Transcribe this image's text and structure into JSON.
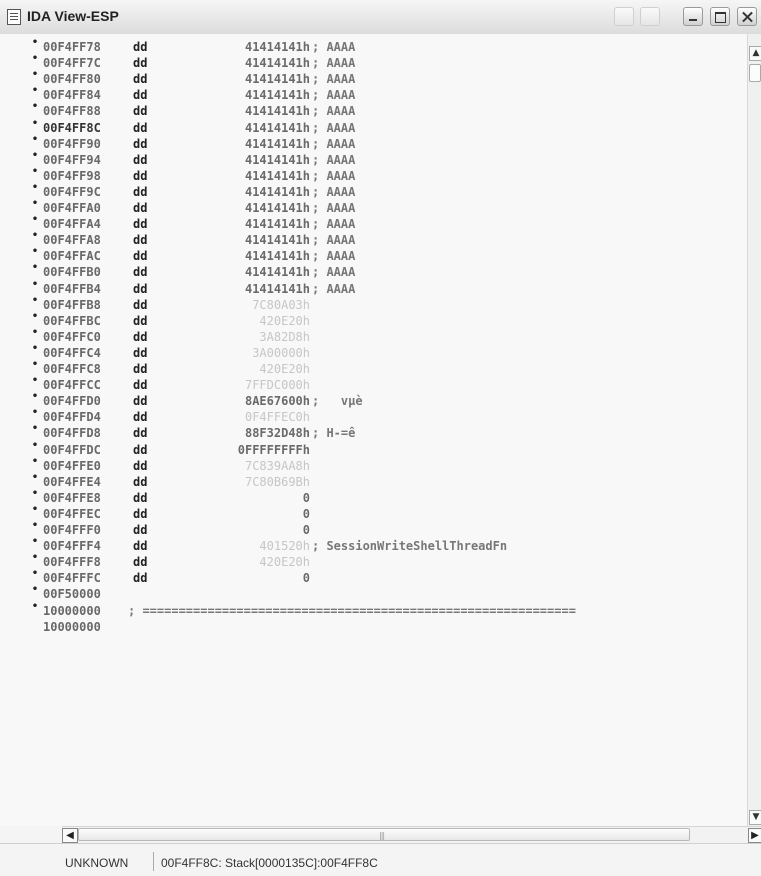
{
  "window": {
    "title": "IDA View-ESP"
  },
  "rows": [
    {
      "addr": "00F4FF78",
      "mn": "dd",
      "op": "41414141h",
      "cm": "; AAAA"
    },
    {
      "addr": "00F4FF7C",
      "mn": "dd",
      "op": "41414141h",
      "cm": "; AAAA"
    },
    {
      "addr": "00F4FF80",
      "mn": "dd",
      "op": "41414141h",
      "cm": "; AAAA"
    },
    {
      "addr": "00F4FF84",
      "mn": "dd",
      "op": "41414141h",
      "cm": "; AAAA"
    },
    {
      "addr": "00F4FF88",
      "mn": "dd",
      "op": "41414141h",
      "cm": "; AAAA"
    },
    {
      "addr": "00F4FF8C",
      "mn": "dd",
      "op": "41414141h",
      "cm": "; AAAA"
    },
    {
      "addr": "00F4FF90",
      "mn": "dd",
      "op": "41414141h",
      "cm": "; AAAA"
    },
    {
      "addr": "00F4FF94",
      "mn": "dd",
      "op": "41414141h",
      "cm": "; AAAA"
    },
    {
      "addr": "00F4FF98",
      "mn": "dd",
      "op": "41414141h",
      "cm": "; AAAA"
    },
    {
      "addr": "00F4FF9C",
      "mn": "dd",
      "op": "41414141h",
      "cm": "; AAAA"
    },
    {
      "addr": "00F4FFA0",
      "mn": "dd",
      "op": "41414141h",
      "cm": "; AAAA"
    },
    {
      "addr": "00F4FFA4",
      "mn": "dd",
      "op": "41414141h",
      "cm": "; AAAA"
    },
    {
      "addr": "00F4FFA8",
      "mn": "dd",
      "op": "41414141h",
      "cm": "; AAAA"
    },
    {
      "addr": "00F4FFAC",
      "mn": "dd",
      "op": "41414141h",
      "cm": "; AAAA"
    },
    {
      "addr": "00F4FFB0",
      "mn": "dd",
      "op": "41414141h",
      "cm": "; AAAA"
    },
    {
      "addr": "00F4FFB4",
      "mn": "dd",
      "op": "41414141h",
      "cm": "; AAAA"
    },
    {
      "addr": "00F4FFB8",
      "mn": "dd",
      "op": "7C80A03h",
      "cm": "",
      "dim": true
    },
    {
      "addr": "00F4FFBC",
      "mn": "dd",
      "op": "420E20h",
      "cm": "",
      "dim": true
    },
    {
      "addr": "00F4FFC0",
      "mn": "dd",
      "op": "3A82D8h",
      "cm": "",
      "dim": true
    },
    {
      "addr": "00F4FFC4",
      "mn": "dd",
      "op": "3A00000h",
      "cm": "",
      "dim": true
    },
    {
      "addr": "00F4FFC8",
      "mn": "dd",
      "op": "420E20h",
      "cm": "",
      "dim": true
    },
    {
      "addr": "00F4FFCC",
      "mn": "dd",
      "op": "7FFDC000h",
      "cm": "",
      "dim": true
    },
    {
      "addr": "00F4FFD0",
      "mn": "dd",
      "op": "8AE67600h",
      "cm": ";   vµè"
    },
    {
      "addr": "00F4FFD4",
      "mn": "dd",
      "op": "0F4FFEC0h",
      "cm": "",
      "dim": true
    },
    {
      "addr": "00F4FFD8",
      "mn": "dd",
      "op": "88F32D48h",
      "cm": "; H-=ê"
    },
    {
      "addr": "00F4FFDC",
      "mn": "dd",
      "op": "0FFFFFFFFh",
      "cm": "",
      "wide": true
    },
    {
      "addr": "00F4FFE0",
      "mn": "dd",
      "op": "7C839AA8h",
      "cm": "",
      "dim": true
    },
    {
      "addr": "00F4FFE4",
      "mn": "dd",
      "op": "7C80B69Bh",
      "cm": "",
      "dim": true
    },
    {
      "addr": "00F4FFE8",
      "mn": "dd",
      "op": "0",
      "cm": ""
    },
    {
      "addr": "00F4FFEC",
      "mn": "dd",
      "op": "0",
      "cm": ""
    },
    {
      "addr": "00F4FFF0",
      "mn": "dd",
      "op": "0",
      "cm": ""
    },
    {
      "addr": "00F4FFF4",
      "mn": "dd",
      "op": "401520h",
      "cm": "; SessionWriteShellThreadFn",
      "dim": true
    },
    {
      "addr": "00F4FFF8",
      "mn": "dd",
      "op": "420E20h",
      "cm": "",
      "dim": true
    },
    {
      "addr": "00F4FFFC",
      "mn": "dd",
      "op": "0",
      "cm": ""
    },
    {
      "addr": "00F50000",
      "mn": "",
      "op": "",
      "cm": ""
    },
    {
      "addr": "10000000",
      "mn": "",
      "op": "",
      "cm": "",
      "sep": "; ============================================================"
    },
    {
      "addr": "10000000",
      "mn": "",
      "op": "",
      "cm": "",
      "nodot": true
    }
  ],
  "status": {
    "mode": "UNKNOWN",
    "location": "00F4FF8C: Stack[0000135C]:00F4FF8C"
  }
}
